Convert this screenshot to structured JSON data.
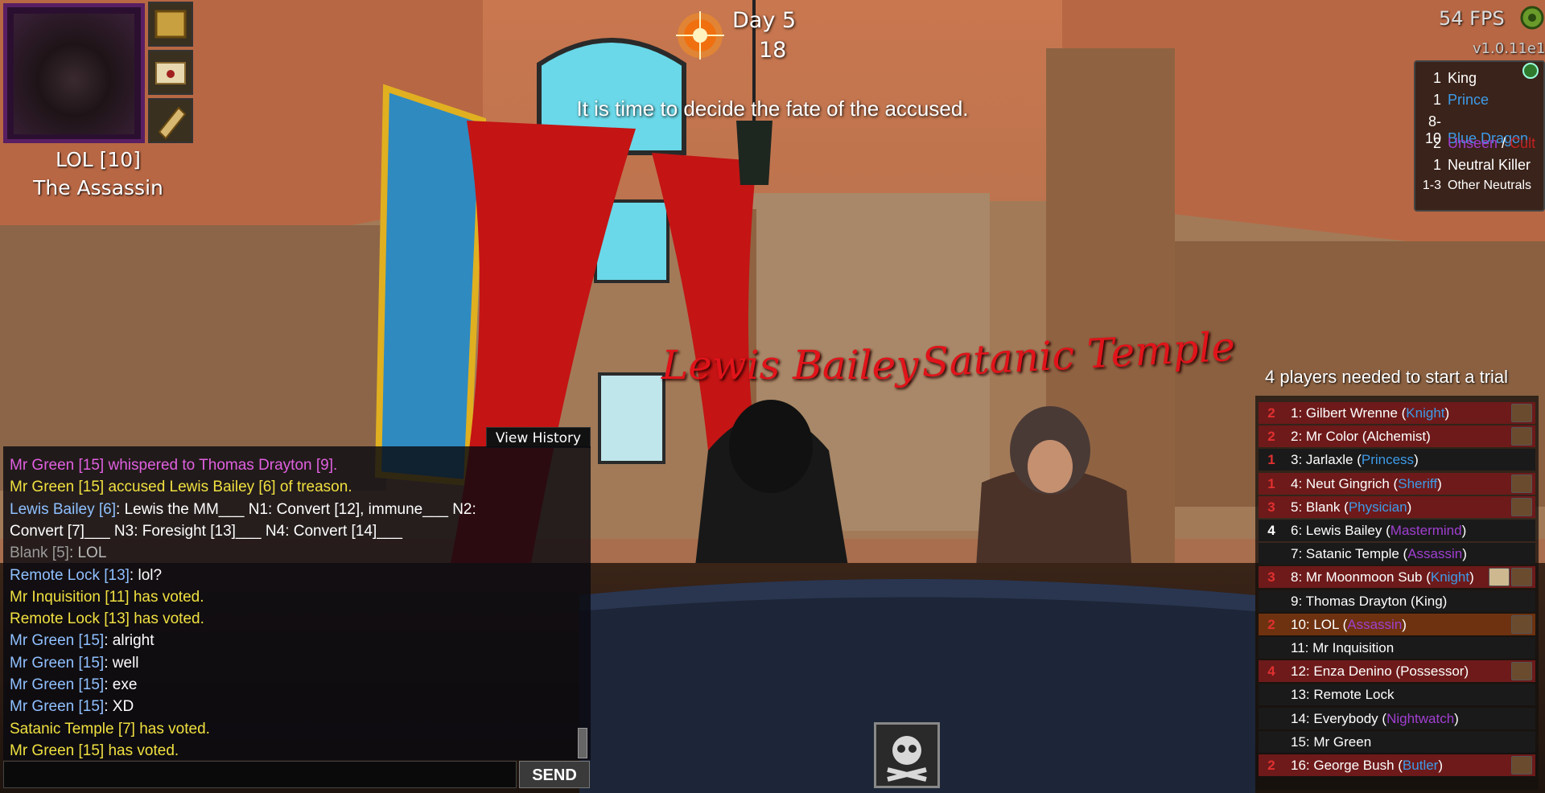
{
  "player": {
    "name": "LOL [10]",
    "role": "The Assassin"
  },
  "clock": {
    "day": "Day 5",
    "timer": "18"
  },
  "announcement": "It is time to decide the fate of the accused.",
  "performance": {
    "fps": "54 FPS",
    "version": "v1.0.11e1"
  },
  "role_list": [
    {
      "count": "1",
      "role": "King",
      "color": "#ffffff"
    },
    {
      "count": "1",
      "role": "Prince",
      "color": "#3d9be8"
    },
    {
      "count": "8-10",
      "role": "Blue Dragon",
      "color": "#3d9be8"
    },
    {
      "count": "2",
      "role_a": "Unseen",
      "sep": " / ",
      "role_b": "Cult",
      "color_a": "#a03fd0",
      "color_b": "#c02020"
    },
    {
      "count": "1",
      "role": "Neutral Killer",
      "color": "#ffffff"
    },
    {
      "count": "1-3",
      "role": "Other Neutrals",
      "color": "#ffffff"
    }
  ],
  "stage_names": {
    "left": "Lewis Bailey",
    "right": "Satanic Temple"
  },
  "trial": {
    "message": "4 players needed to start a trial"
  },
  "players": [
    {
      "votes": "2",
      "name": "1: Gilbert Wrenne (",
      "role": "Knight",
      "role_class": "blue",
      "tail": ")"
    },
    {
      "votes": "2",
      "name": "2: Mr Color (Alchemist)",
      "role": "",
      "role_class": "",
      "tail": ""
    },
    {
      "votes": "1",
      "name": "3: Jarlaxle (",
      "role": "Princess",
      "role_class": "blue",
      "tail": ")"
    },
    {
      "votes": "1",
      "name": "4: Neut Gingrich (",
      "role": "Sheriff",
      "role_class": "blue",
      "tail": ")"
    },
    {
      "votes": "3",
      "name": "5: Blank (",
      "role": "Physician",
      "role_class": "blue",
      "tail": ")"
    },
    {
      "votes": "4",
      "name": "6: Lewis Bailey (",
      "role": "Mastermind",
      "role_class": "purple",
      "tail": ")"
    },
    {
      "votes": "",
      "name": "7: Satanic Temple (",
      "role": "Assassin",
      "role_class": "purple",
      "tail": ")"
    },
    {
      "votes": "3",
      "name": "8: Mr Moonmoon Sub (",
      "role": "Knight",
      "role_class": "blue",
      "tail": ")"
    },
    {
      "votes": "",
      "name": "9: Thomas Drayton (King)",
      "role": "",
      "role_class": "",
      "tail": ""
    },
    {
      "votes": "2",
      "name": "10: LOL (",
      "role": "Assassin",
      "role_class": "purple",
      "tail": ")"
    },
    {
      "votes": "",
      "name": "11: Mr Inquisition",
      "role": "",
      "role_class": "",
      "tail": ""
    },
    {
      "votes": "4",
      "name": "12: Enza Denino (Possessor)",
      "role": "",
      "role_class": "",
      "tail": ""
    },
    {
      "votes": "",
      "name": "13: Remote Lock",
      "role": "",
      "role_class": "",
      "tail": ""
    },
    {
      "votes": "",
      "name": "14: Everybody (",
      "role": "Nightwatch",
      "role_class": "purple",
      "tail": ")"
    },
    {
      "votes": "",
      "name": "15: Mr Green",
      "role": "",
      "role_class": "",
      "tail": ""
    },
    {
      "votes": "2",
      "name": "16: George Bush (",
      "role": "Butler",
      "role_class": "blue",
      "tail": ")"
    }
  ],
  "chat": {
    "history_label": "View History",
    "send_label": "SEND",
    "input_value": "",
    "lines": [
      {
        "text": "Mr Green [15] whispered to Thomas Drayton [9].",
        "color": "#e060e0"
      },
      {
        "text": "Mr Green [15] accused Lewis Bailey [6] of treason.",
        "color": "#f0e040"
      },
      {
        "speaker": "Lewis Bailey [6]",
        "speaker_color": "#8fc0ff",
        "text": ": Lewis the MM___ N1: Convert [12], immune___ N2:",
        "color": "#ffffff"
      },
      {
        "text": "Convert [7]___ N3: Foresight [13]___ N4: Convert [14]___",
        "color": "#ffffff"
      },
      {
        "speaker": "Blank [5]",
        "speaker_color": "#9a9a9a",
        "text": ": LOL",
        "color": "#bbbbbb"
      },
      {
        "speaker": "Remote Lock [13]",
        "speaker_color": "#8fc0ff",
        "text": ": lol?",
        "color": "#ffffff"
      },
      {
        "text": "Mr Inquisition [11] has voted.",
        "color": "#f0e040"
      },
      {
        "text": "Remote Lock [13] has voted.",
        "color": "#f0e040"
      },
      {
        "speaker": "Mr Green [15]",
        "speaker_color": "#8fc0ff",
        "text": ": alright",
        "color": "#ffffff"
      },
      {
        "speaker": "Mr Green [15]",
        "speaker_color": "#8fc0ff",
        "text": ": well",
        "color": "#ffffff"
      },
      {
        "speaker": "Mr Green [15]",
        "speaker_color": "#8fc0ff",
        "text": ": exe",
        "color": "#ffffff"
      },
      {
        "speaker": "Mr Green [15]",
        "speaker_color": "#8fc0ff",
        "text": ": XD",
        "color": "#ffffff"
      },
      {
        "text": "Satanic Temple [7] has voted.",
        "color": "#f0e040"
      },
      {
        "text": "Mr Green [15] has voted.",
        "color": "#f0e040"
      }
    ]
  },
  "icons": {
    "sun": "sun-icon",
    "gear": "gear-icon",
    "skull": "skull-crossbones-icon",
    "book": "journal-icon",
    "scroll": "scroll-icon",
    "letter": "letter-icon"
  }
}
